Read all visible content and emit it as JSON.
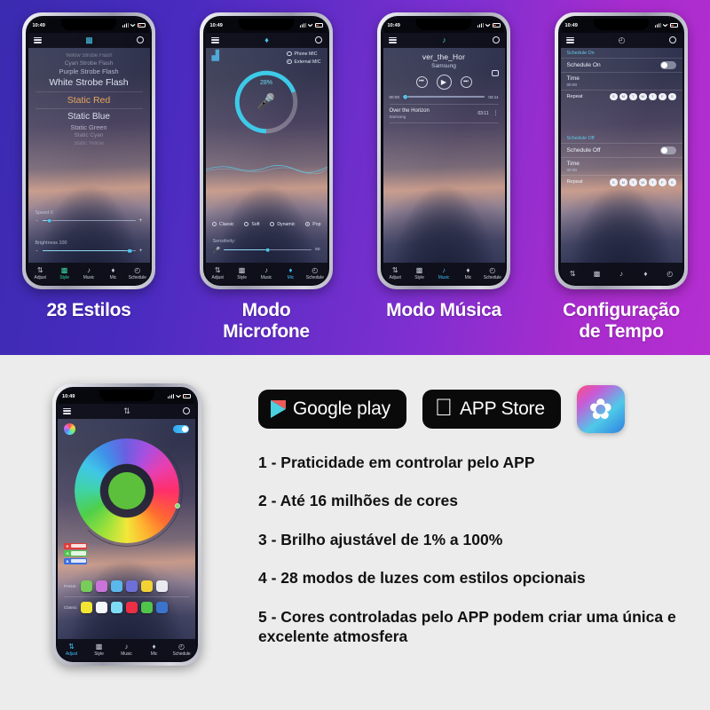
{
  "theme": {
    "gradient_start": "#3a2bb0",
    "gradient_end": "#b52ed0",
    "bottom_bg": "#ececec",
    "accent_green": "#3ad6a5",
    "accent_blue": "#41b6f0",
    "accent_orange": "#e8a760"
  },
  "top_panel": {
    "captions": [
      "28 Estilos",
      "Modo\nMicrofone",
      "Modo Música",
      "Configuração\nde Tempo"
    ]
  },
  "status_bar": {
    "time": "10:49",
    "location_icon": "location-arrow-icon"
  },
  "tabs": [
    {
      "label": "Adjust",
      "icon": "sliders-icon"
    },
    {
      "label": "Style",
      "icon": "grid-icon"
    },
    {
      "label": "Music",
      "icon": "music-note-icon"
    },
    {
      "label": "Mic",
      "icon": "microphone-icon"
    },
    {
      "label": "Schedule",
      "icon": "clock-icon"
    }
  ],
  "phone_style": {
    "active_tab": "Style",
    "appbar_icon": "grid-icon",
    "styles": [
      "Yellow Strobe Flash",
      "Cyan Strobe Flash",
      "Purple Strobe Flash",
      "White Strobe Flash",
      "Static Red",
      "Static Blue",
      "Static Green",
      "Static Cyan",
      "Static Yellow"
    ],
    "selected_style": "Static Red",
    "speed": {
      "label": "Speed 0",
      "value": 8,
      "minus": "-",
      "plus": "+"
    },
    "brightness": {
      "label": "Brightness 100",
      "value": 96,
      "minus": "-",
      "plus": "+"
    }
  },
  "phone_mic": {
    "active_tab": "Mic",
    "appbar_icon": "microphone-icon",
    "sources": [
      {
        "label": "Phone MIC",
        "selected": false
      },
      {
        "label": "External MIC",
        "selected": true
      }
    ],
    "gauge_percent": "28%",
    "modes": [
      {
        "label": "Classic",
        "selected": false
      },
      {
        "label": "Soft",
        "selected": false
      },
      {
        "label": "Dynamic",
        "selected": false
      },
      {
        "label": "Pop",
        "selected": true
      }
    ],
    "sensitivity": {
      "label": "Sensitivity:",
      "value": "50",
      "percent": 50
    }
  },
  "phone_music": {
    "active_tab": "Music",
    "appbar_icon": "music-note-icon",
    "track_title": "ver_the_Hor",
    "artist": "Samsung",
    "elapsed": "00:00",
    "duration": "03:11",
    "controls": {
      "prev": "⏮",
      "play": "▶",
      "next": "⏭",
      "repeat": "repeat-icon"
    },
    "list_item": {
      "title": "Over the Horizon",
      "artist": "Samsung",
      "duration": "03:11"
    }
  },
  "phone_schedule": {
    "active_tab": "Schedule",
    "appbar_icon": "clock-icon",
    "sections": [
      {
        "header": "Schedule On",
        "row_label": "Schedule On",
        "toggle_on": false,
        "time_label": "Time",
        "time_value": "00:00",
        "repeat_label": "Repeat",
        "days": [
          "S",
          "M",
          "T",
          "W",
          "T",
          "F",
          "S"
        ]
      },
      {
        "header": "Schedule Off",
        "row_label": "Schedule Off",
        "toggle_on": false,
        "time_label": "Time",
        "time_value": "00:00",
        "repeat_label": "Repeat",
        "days": [
          "S",
          "M",
          "T",
          "W",
          "T",
          "F",
          "S"
        ]
      }
    ]
  },
  "phone_color": {
    "active_tab": "Adjust",
    "appbar_icon": "sliders-icon",
    "power_toggle_on": true,
    "wheel_selected_color": "#5cc03c",
    "rgb": [
      {
        "channel": "R",
        "color": "#e03b3b"
      },
      {
        "channel": "G",
        "color": "#4fc24f"
      },
      {
        "channel": "B",
        "color": "#3b6fe0"
      }
    ],
    "preset": {
      "label": "Preset",
      "colors": [
        "#77cc5a",
        "#c974d8",
        "#5bb8ea",
        "#6f6fd8",
        "#f2d234",
        "#e8eaf0"
      ]
    },
    "classic": {
      "label": "Classic",
      "colors": [
        "#f2e534",
        "#f6f7fa",
        "#7fdcf5",
        "#ec2f45",
        "#4fc64a",
        "#3b74cc"
      ]
    }
  },
  "bottom_panel": {
    "badges": [
      {
        "name": "google-play",
        "label": "Google play",
        "icon": "play-triangle-icon"
      },
      {
        "name": "app-store",
        "label": "APP Store",
        "icon": "apple-logo-icon"
      }
    ],
    "app_icon": {
      "name": "lotus-app-icon",
      "glyph": "✿"
    },
    "features": [
      "1 - Praticidade em controlar pelo APP",
      "2 - Até 16 milhões de cores",
      "3 - Brilho ajustável de 1% a 100%",
      "4 - 28 modos de luzes com estilos opcionais",
      "5 - Cores controladas pelo APP podem criar uma única e excelente atmosfera"
    ]
  }
}
